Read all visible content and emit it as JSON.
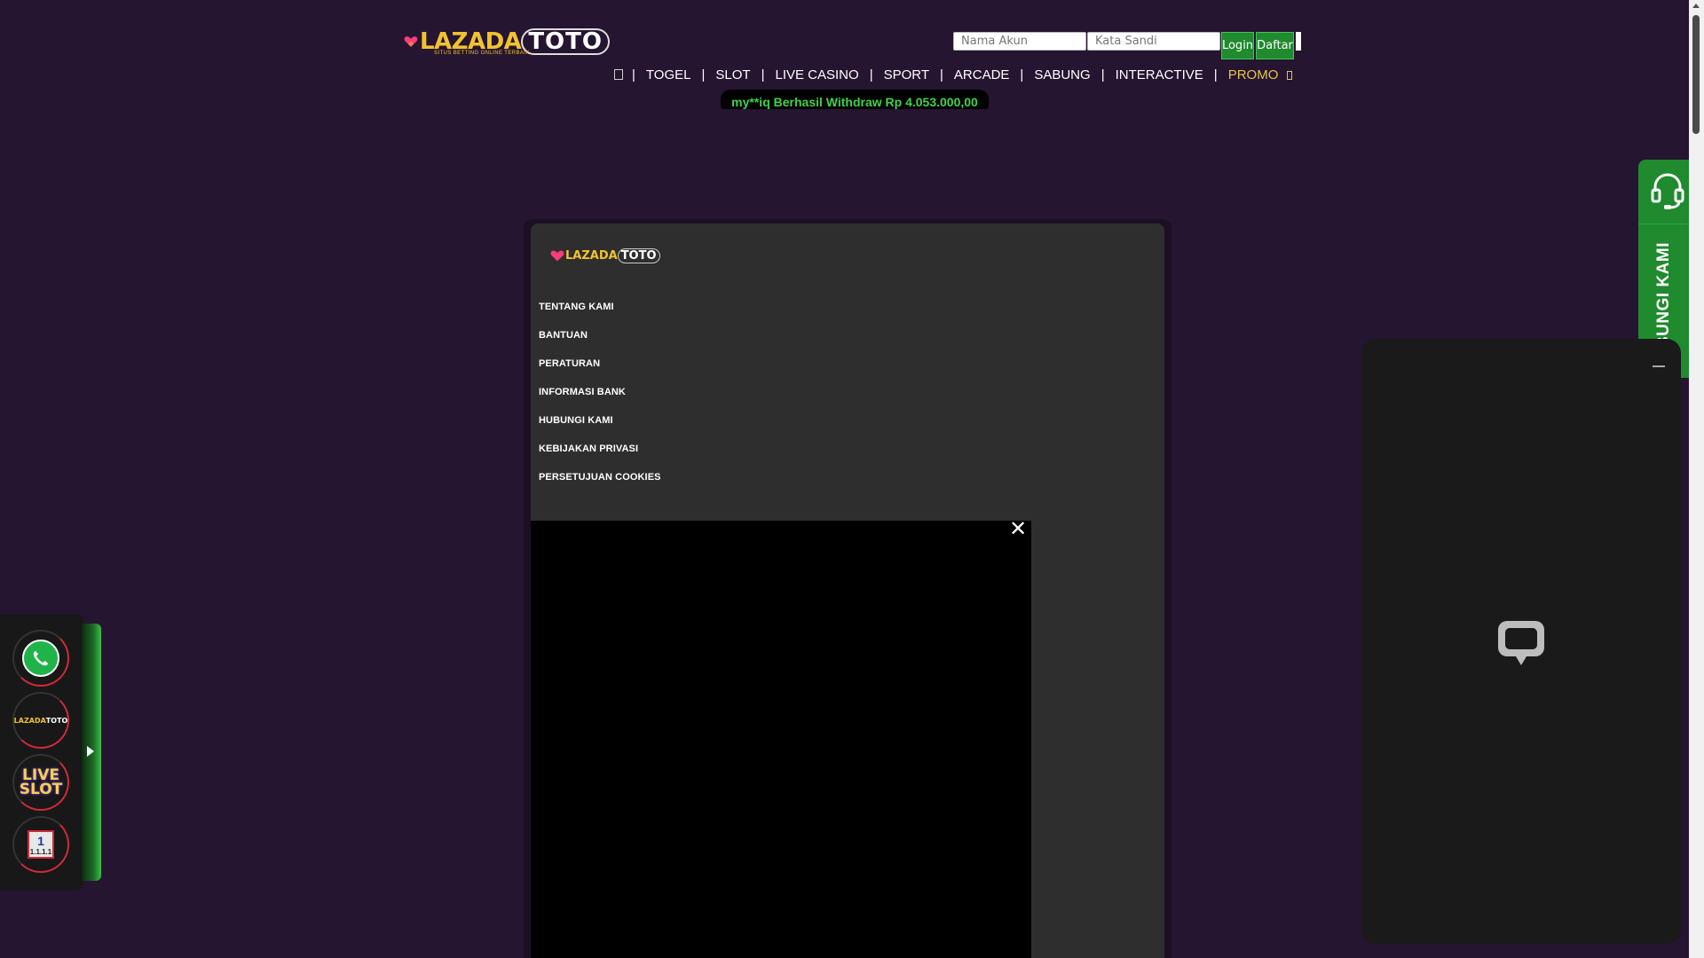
{
  "logo": {
    "word1": "LAZADA",
    "word2": "TOTO",
    "tagline": "SITUS BETTING ONLINE TERBAIK"
  },
  "login": {
    "username_placeholder": "Nama Akun",
    "password_placeholder": "Kata Sandi",
    "login_label": "Login",
    "register_label": "Daftar"
  },
  "nav": {
    "home_icon": "home-icon",
    "items": [
      "TOGEL",
      "SLOT",
      "LIVE CASINO",
      "SPORT",
      "ARCADE",
      "SABUNG",
      "INTERACTIVE"
    ],
    "separator": "|",
    "promo": "PROMO"
  },
  "ticker": {
    "text": "my**iq Berhasil Withdraw Rp 4.053.000,00"
  },
  "footer": {
    "links": [
      "TENTANG KAMI",
      "BANTUAN",
      "PERATURAN",
      "INFORMASI BANK",
      "HUBUNGI KAMI",
      "KEBIJAKAN PRIVASI",
      "PERSETUJUAN COOKIES"
    ]
  },
  "video": {
    "close_symbol": "✕"
  },
  "chat": {
    "tab_label": "HUBUNGI KAMI",
    "icon": "headset-icon",
    "bubble_icon": "chat-bubble-icon"
  },
  "dock": {
    "items": [
      "whatsapp-icon",
      "lazadatoto-logo",
      "live-slot-icon",
      "calendar-promo-icon"
    ],
    "mini_logo_word1": "LAZADA",
    "mini_logo_word2": "TOTO",
    "live_slot_line1": "LIVE",
    "live_slot_line2": "SLOT",
    "calendar_number": "1",
    "calendar_caption": "1.1.1.1"
  },
  "colors": {
    "background": "#251530",
    "accent_green": "#1f8a2e",
    "ticker_text": "#3ed24a",
    "gold": "#f2c230",
    "promo": "#e5c54a",
    "panel": "#2e2e2e"
  }
}
